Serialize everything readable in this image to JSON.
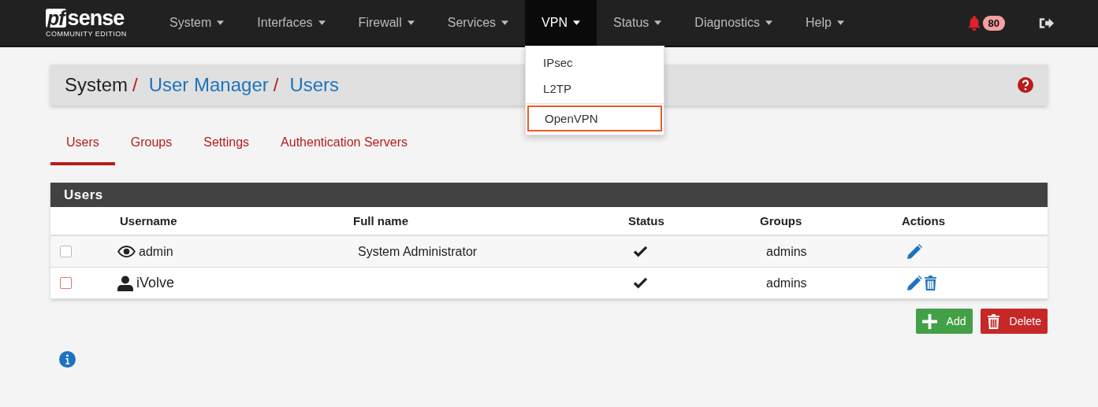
{
  "logo": {
    "mark": "pf",
    "word": "sense",
    "edition": "COMMUNITY EDITION"
  },
  "nav": [
    {
      "label": "System",
      "selected": false
    },
    {
      "label": "Interfaces",
      "selected": false
    },
    {
      "label": "Firewall",
      "selected": false
    },
    {
      "label": "Services",
      "selected": false
    },
    {
      "label": "VPN",
      "selected": true
    },
    {
      "label": "Status",
      "selected": false
    },
    {
      "label": "Diagnostics",
      "selected": false
    },
    {
      "label": "Help",
      "selected": false
    }
  ],
  "vpn_menu": [
    {
      "label": "IPsec",
      "selected": false
    },
    {
      "label": "L2TP",
      "selected": false
    },
    {
      "label": "OpenVPN",
      "selected": true
    }
  ],
  "notifications": {
    "count": "80"
  },
  "breadcrumb": [
    {
      "label": "System",
      "link": false,
      "separator": "/"
    },
    {
      "label": "User Manager",
      "link": true,
      "separator": "/"
    },
    {
      "label": "Users",
      "link": true
    }
  ],
  "tabs": [
    {
      "label": "Users",
      "selected": true
    },
    {
      "label": "Groups",
      "selected": false
    },
    {
      "label": "Settings",
      "selected": false
    },
    {
      "label": "Authentication Servers",
      "selected": false
    }
  ],
  "table": {
    "title": "Users",
    "columns": [
      "Username",
      "Full name",
      "Status",
      "Groups",
      "Actions"
    ],
    "rows": [
      {
        "kind": "system",
        "checked": false,
        "username": "admin",
        "full_name": "System Administrator",
        "enabled": true,
        "groups": "admins"
      },
      {
        "kind": "user",
        "checked": false,
        "username": "iVolve",
        "enabled": true,
        "groups": "admins"
      }
    ]
  },
  "buttons": [
    {
      "kind": "add",
      "label": "Add"
    },
    {
      "kind": "delete",
      "label": "Delete"
    }
  ]
}
